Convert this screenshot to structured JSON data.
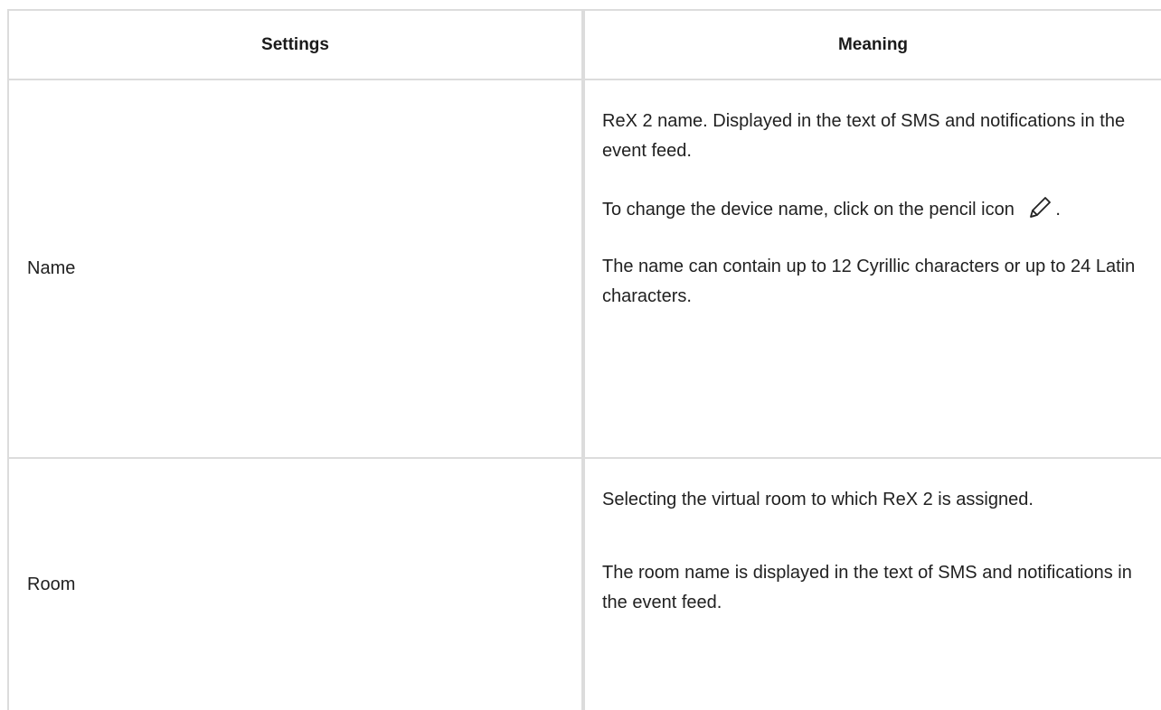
{
  "table": {
    "headers": {
      "settings": "Settings",
      "meaning": "Meaning"
    },
    "rows": [
      {
        "setting": "Name",
        "meaning": {
          "p1": "ReX 2 name. Displayed in the text of SMS and notifications in the event feed.",
          "p2_before_icon": "To change the device name, click on the pencil icon",
          "p2_icon": "pencil-icon",
          "p2_after_icon": ".",
          "p3": "The name can contain up to 12 Cyrillic characters or up to 24 Latin characters."
        }
      },
      {
        "setting": "Room",
        "meaning": {
          "p1": "Selecting the virtual room to which ReX 2 is assigned.",
          "p2": "The room name is displayed in the text of SMS and notifications in the event feed."
        }
      }
    ]
  },
  "colors": {
    "border": "#dcdcdc",
    "text": "#212121"
  }
}
